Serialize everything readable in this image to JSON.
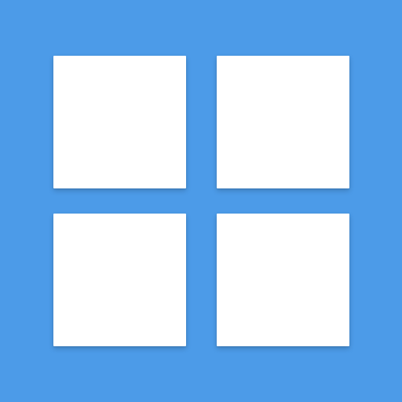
{
  "icon": {
    "name": "grid-icon",
    "background_color": "#4C9BE8",
    "tile_color": "#FFFFFF",
    "tiles": [
      "top-left",
      "top-right",
      "bottom-left",
      "bottom-right"
    ]
  }
}
